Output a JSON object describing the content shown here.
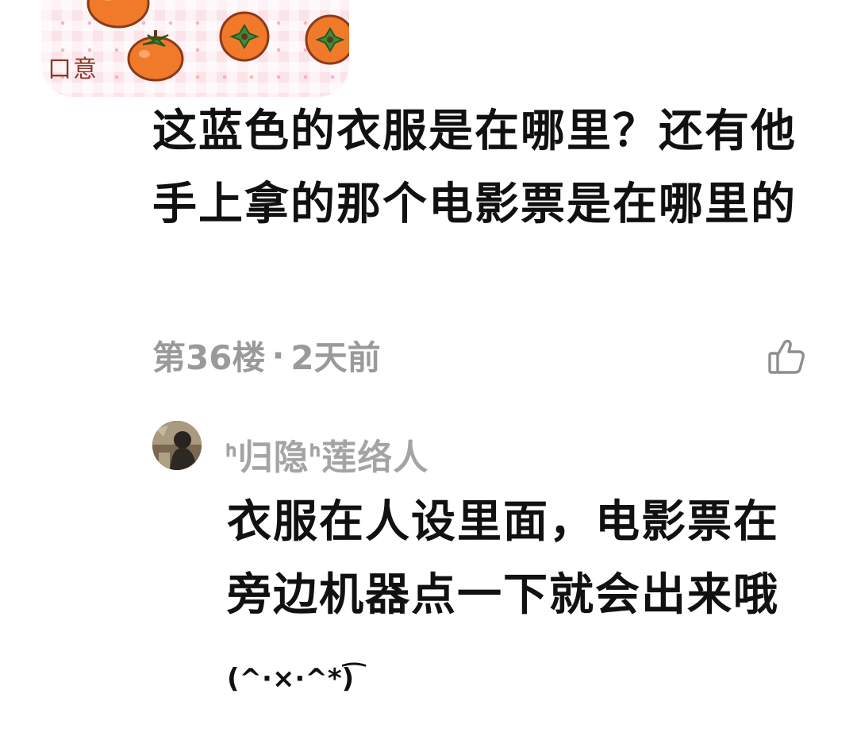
{
  "comment": {
    "name_tag": "口意",
    "text": "这蓝色的衣服是在哪里？还有他手上拿的那个电影票是在哪里的",
    "floor": "第36楼",
    "separator": "·",
    "time": "2天前",
    "like_icon": "thumbs-up-icon"
  },
  "reply": {
    "avatar_icon": "user-avatar",
    "username": "ᑋ归隐ᑋ莲络人",
    "text": "衣服在人设里面，电影票在旁边机器点一下就会出来哦",
    "emoticon": "(^·×·^*)͡"
  },
  "colors": {
    "text_primary": "#111111",
    "text_secondary": "#9a9a9a",
    "username": "#a4a4a4",
    "persimmon": "#f07a2a",
    "tag_background": "#fbe3e8"
  }
}
